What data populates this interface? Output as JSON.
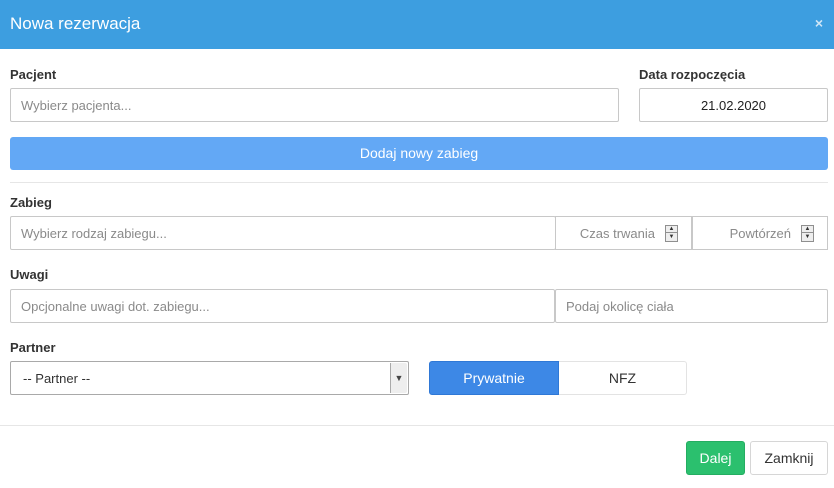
{
  "header": {
    "title": "Nowa rezerwacja",
    "close_symbol": "×"
  },
  "patient": {
    "label": "Pacjent",
    "placeholder": "Wybierz pacjenta..."
  },
  "start_date": {
    "label": "Data rozpoczęcia",
    "value": "21.02.2020"
  },
  "add_treatment_button": "Dodaj nowy zabieg",
  "treatment": {
    "label": "Zabieg",
    "placeholder": "Wybierz rodzaj zabiegu...",
    "duration_placeholder": "Czas trwania",
    "repetitions_placeholder": "Powtórzeń"
  },
  "notes": {
    "label": "Uwagi",
    "notes_placeholder": "Opcjonalne uwagi dot. zabiegu...",
    "body_area_placeholder": "Podaj okolicę ciała"
  },
  "partner": {
    "label": "Partner",
    "selected": "-- Partner --"
  },
  "payment_toggle": {
    "private_label": "Prywatnie",
    "nfz_label": "NFZ",
    "active": "Prywatnie"
  },
  "footer": {
    "next_label": "Dalej",
    "close_label": "Zamknij"
  },
  "colors": {
    "header_bg": "#3d9ee0",
    "add_button_bg": "#63a8f5",
    "active_toggle_bg": "#3d88e6",
    "next_button_bg": "#2bc06e"
  },
  "icons": {
    "close": "close-icon",
    "spinner": "spinner-arrows-icon",
    "select_arrow": "chevron-down-icon"
  }
}
